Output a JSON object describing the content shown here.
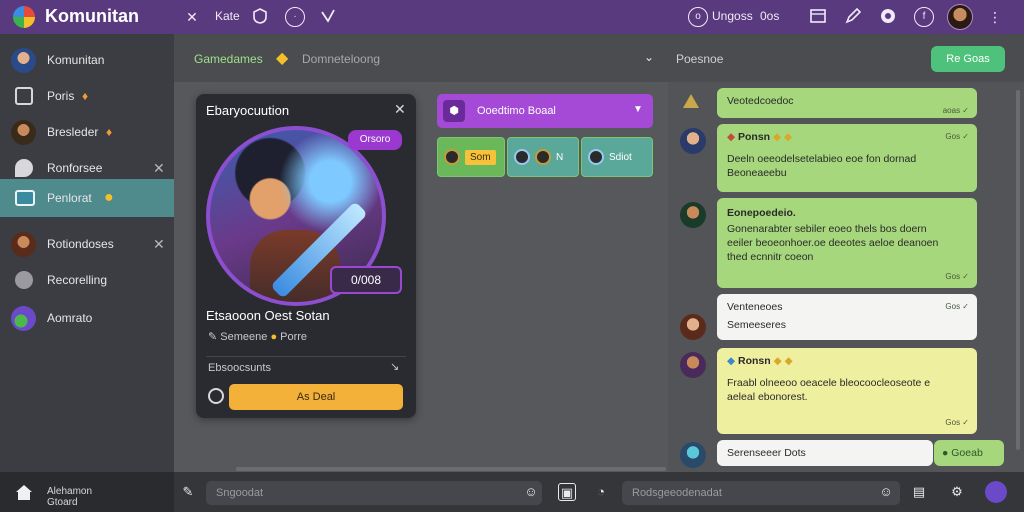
{
  "app": {
    "title": "Komunitan"
  },
  "topbar": {
    "label_1": "Kate",
    "status": "Ungoss",
    "status_badge": "0os"
  },
  "sidebar": {
    "items": [
      {
        "label": "Komunitan",
        "active": false
      },
      {
        "label": "Poris",
        "badge": "♦",
        "active": false
      },
      {
        "label": "Bresleder",
        "badge": "♦",
        "active": false
      },
      {
        "label": "Ronforsee",
        "closable": true,
        "active": false
      },
      {
        "label": "Penlorat",
        "badge": "●",
        "active": true
      },
      {
        "label": "Rotiondoses",
        "closable": true,
        "active": false
      },
      {
        "label": "Recorelling",
        "active": false
      },
      {
        "label": "Aomrato",
        "active": false
      }
    ],
    "footer": {
      "line1": "Alehamon",
      "line2": "Gtoard"
    }
  },
  "center": {
    "tab_active": "Gamedames",
    "tab_inactive": "Domneteloong"
  },
  "right_header": {
    "title": "Poesnoe",
    "button_label": "Re Goas"
  },
  "card": {
    "title": "Ebaryocuution",
    "pill": "Orsoro",
    "stat": "0/008",
    "name": "Etsaooon Oest Sotan",
    "sub_left": "Semeene",
    "sub_right": "Porre",
    "footer_label": "Ebsoocsunts",
    "action_label": "As Deal"
  },
  "dropdown": {
    "label": "Ooedtimo Boaal",
    "options": [
      {
        "label": "Som"
      },
      {
        "label": "N"
      },
      {
        "label": "Sdiot"
      }
    ]
  },
  "chat": {
    "messages": [
      {
        "lines": [
          "Veotedcoedoc"
        ],
        "meta": "aoas ✓",
        "style": "green"
      },
      {
        "head": "Ponsn",
        "lines": [
          "Deeln oeeodelsetelabieo eoe fon dornad",
          "Beoneaeebu"
        ],
        "meta": "Gos ✓",
        "style": "green"
      },
      {
        "head": "Eonepoedeio.",
        "lines": [
          "Gonenarabter sebiler eoeo thels bos doern",
          "eeiler beoeonhoer.oe deeotes aeloe deanoen",
          "thed ecnnitr coeon"
        ],
        "meta": "Gos ✓",
        "style": "green"
      },
      {
        "lines": [
          "Venteneoes",
          "Semeeseres"
        ],
        "meta": "Gos ✓",
        "style": "white"
      },
      {
        "head": "Ronsn",
        "lines": [
          "Fraabl olneeoo oeacele bleocoocleoseote e",
          "aeleal ebonorest."
        ],
        "meta": "Gos ✓",
        "style": "yellow"
      },
      {
        "lines": [
          "Serenseeer Dots"
        ],
        "style": "white",
        "chip": "Goeab"
      }
    ]
  },
  "bottombar": {
    "input_left": "Sngoodat",
    "input_right": "Rodsgeeodenadat"
  },
  "colors": {
    "topbar": "#5a3a7e",
    "accent_purple": "#a44ad6",
    "accent_green": "#4ec27a",
    "action_yellow": "#f3b13a"
  }
}
